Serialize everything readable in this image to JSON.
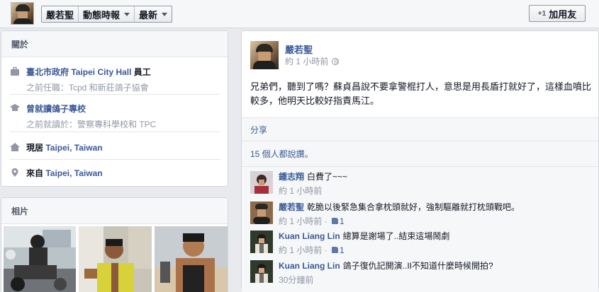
{
  "topbar": {
    "profile_name": "嚴若聖",
    "activity_label": "動態時報",
    "recent_label": "最新",
    "add_friend_label": "加用友"
  },
  "about": {
    "title": "關於",
    "items": [
      {
        "icon": "briefcase-icon",
        "main_link": "臺北市政府 Taipei City Hall",
        "main_suffix": " 員工",
        "sub": "之前任職：Tcpd 和新莊鴿子協會"
      },
      {
        "icon": "school-icon",
        "main_link": "曾就讀鴿子專校",
        "sub": "之前就讀於：警察專科學校和 TPC"
      },
      {
        "icon": "home-icon",
        "main_prefix": "現居 ",
        "main_link": "Taipei, Taiwan"
      },
      {
        "icon": "location-pin-icon",
        "main_prefix": "來自 ",
        "main_link": "Taipei, Taiwan"
      }
    ]
  },
  "photos": {
    "title": "相片"
  },
  "post": {
    "author": "嚴若聖",
    "time": "約 1 小時前",
    "text": "兄弟們，聽到了嗎？蘇貞昌說不要拿警棍打人，意思是用長盾打就好了，這樣血噴比較多，他明天比較好指責馬江。",
    "share_label": "分享",
    "likes_text": "15 個人都說讚。",
    "comments": [
      {
        "name": "鍾志翔",
        "text": "白費了~~~",
        "time": "約 1 小時前",
        "likes": ""
      },
      {
        "name": "嚴若聖",
        "text": "乾脆以後緊急集合拿枕頭就好，強制驅離就打枕頭戰吧。",
        "time": "約 1 小時前",
        "likes": "1"
      },
      {
        "name": "Kuan Liang Lin",
        "text": "總算是謝場了..結束這場鬧劇",
        "time": "約 1 小時前",
        "likes": "1"
      },
      {
        "name": "Kuan Liang Lin",
        "text": "鴿子復仇記開演..II不知道什麼時候開拍?",
        "time": "30分鐘前",
        "likes": ""
      }
    ]
  }
}
